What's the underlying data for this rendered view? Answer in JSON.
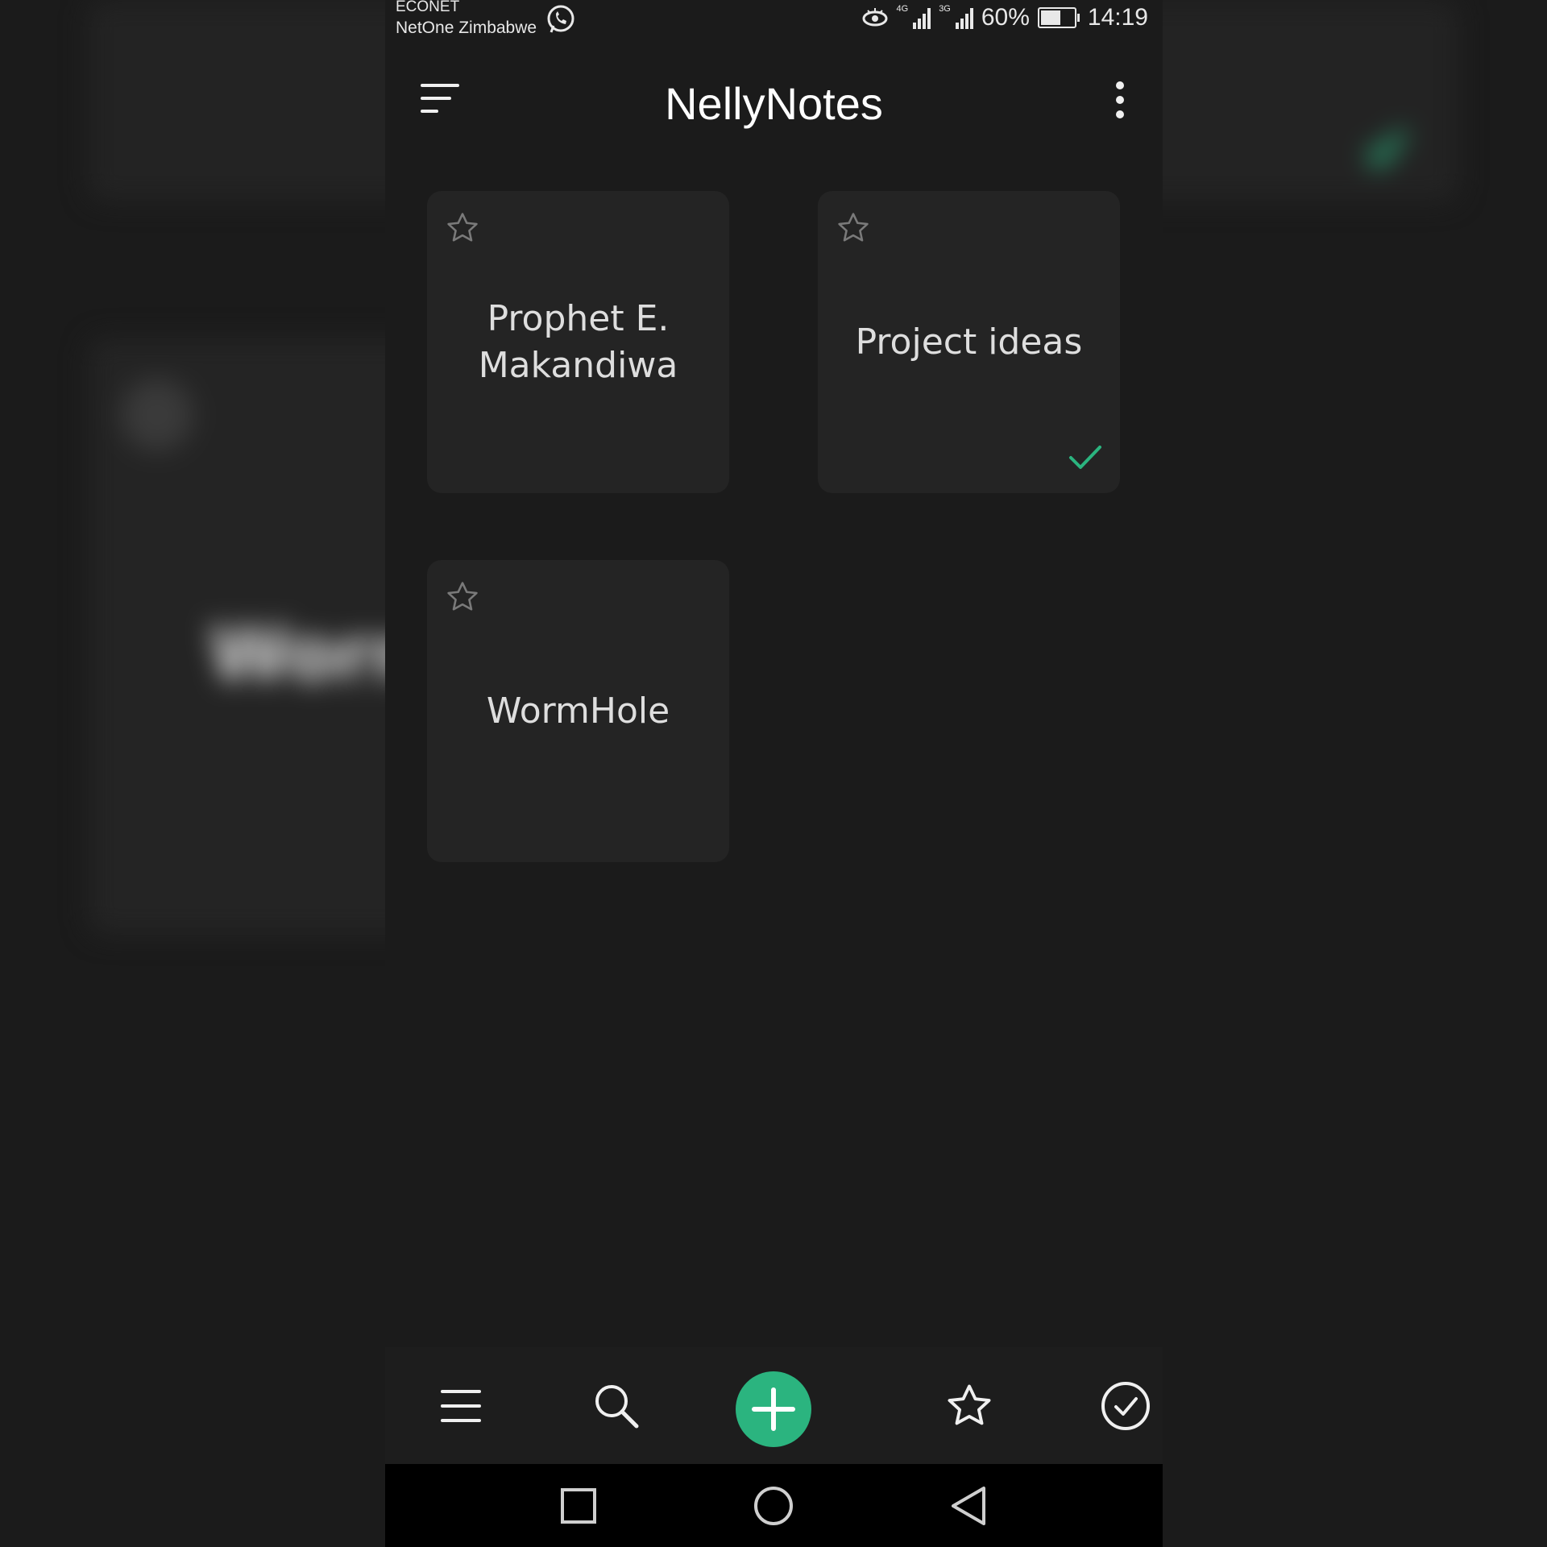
{
  "status_bar": {
    "carrier_primary": "ECONET",
    "carrier_secondary": "NetOne Zimbabwe",
    "network_1": "4G",
    "network_2": "3G",
    "battery_percent": "60%",
    "battery_level": 0.6,
    "time": "14:19"
  },
  "app_bar": {
    "title": "NellyNotes"
  },
  "notes": [
    {
      "title": "Prophet E. Makandiwa",
      "starred": false,
      "completed": false
    },
    {
      "title": "Project ideas",
      "starred": false,
      "completed": true
    },
    {
      "title": "WormHole",
      "starred": false,
      "completed": false
    }
  ],
  "bottom_nav": {
    "items": [
      "menu-icon",
      "search-icon",
      "add-icon",
      "star-icon",
      "check-circle-icon"
    ],
    "accent_color": "#2bb47f"
  },
  "background_blur_text": "Worm",
  "colors": {
    "background": "#1b1b1b",
    "card": "#242424",
    "accent": "#2bb47f"
  }
}
